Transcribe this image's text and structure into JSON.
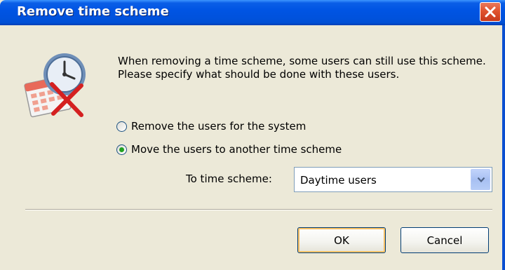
{
  "window": {
    "title": "Remove time scheme"
  },
  "message": "When removing a time scheme, some users can still use this scheme. Please specify what should be done with these users.",
  "options": [
    {
      "label": "Remove the users for the system",
      "checked": false
    },
    {
      "label": "Move the users to another time scheme",
      "checked": true
    }
  ],
  "target": {
    "label": "To time scheme:",
    "value": "Daytime users"
  },
  "buttons": {
    "ok": "OK",
    "cancel": "Cancel"
  },
  "icons": {
    "dialog": "calendar-clock-delete-icon",
    "close": "close-icon",
    "dropdown": "chevron-down-icon"
  },
  "colors": {
    "titlebar": "#0054e3",
    "close": "#e0532e",
    "dialog_bg": "#ece9d8",
    "default_button_glow": "#f9c266"
  }
}
